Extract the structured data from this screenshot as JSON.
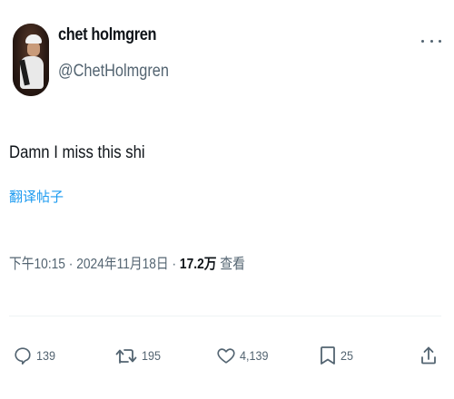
{
  "author": {
    "display_name": "chet holmgren",
    "handle": "@ChetHolmgren",
    "avatar_icon": "profile-photo"
  },
  "tweet": {
    "text": "Damn I miss this shi",
    "translate_label": "翻译帖子"
  },
  "meta": {
    "time": "下午10:15",
    "separator": "·",
    "date": "2024年11月18日",
    "views_count": "17.2万",
    "views_label": "查看"
  },
  "actions": {
    "reply": {
      "icon": "reply-bubble-icon",
      "count": "139"
    },
    "retweet": {
      "icon": "retweet-icon",
      "count": "195"
    },
    "like": {
      "icon": "heart-icon",
      "count": "4,139"
    },
    "bookmark": {
      "icon": "bookmark-icon",
      "count": "25"
    },
    "share": {
      "icon": "share-upload-icon"
    }
  },
  "colors": {
    "text_primary": "#0f1419",
    "text_secondary": "#536471",
    "link": "#1d9bf0",
    "divider": "#eff3f4"
  }
}
